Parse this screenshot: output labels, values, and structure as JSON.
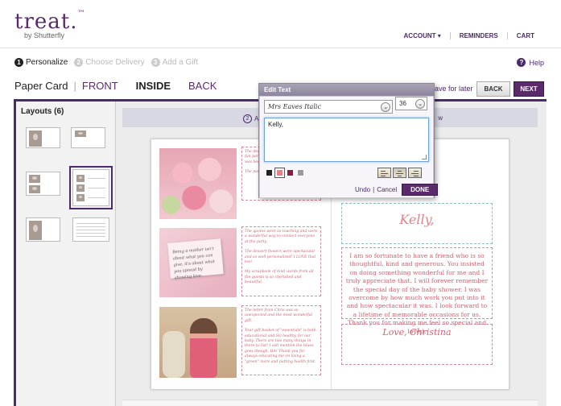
{
  "brand": {
    "name": "treat.",
    "trademark": "™",
    "sub": "by Shutterfly"
  },
  "topnav": {
    "account": "ACCOUNT ▾",
    "reminders": "REMINDERS",
    "cart": "CART"
  },
  "steps": [
    {
      "num": "1",
      "label": "Personalize"
    },
    {
      "num": "2",
      "label": "Choose Delivery"
    },
    {
      "num": "3",
      "label": "Add a Gift"
    }
  ],
  "help": {
    "icon": "?",
    "label": "Help"
  },
  "tabs": {
    "card": "Paper Card",
    "front": "FRONT",
    "inside": "INSIDE",
    "back": "BACK"
  },
  "actions": {
    "save_later": "ave for later",
    "back": "BACK",
    "next": "NEXT"
  },
  "layouts": {
    "title": "Layouts (6)"
  },
  "toolbar": {
    "step_num": "2",
    "left_text": "A",
    "right_text": "w"
  },
  "card_left": {
    "box1": [
      "The decor",
      "fun party",
      "was beau",
      "The party"
    ],
    "box2": [
      "The quotes were so touching and were a wonderful way to connect everyone at the party.",
      "The dessert flowers were spectacular and so well personalized! I LOVE that too!",
      "My scrapbook of kind words from all the guests is so cherished and beautiful."
    ],
    "box3": [
      "The letter from Chris was so unexpected and the most wonderful gift.",
      "Your gift basket of \"essentials\" is both educational and SO healthy for our baby. There are two many things in there to list! I will mention the blues goes though. HA! Thank you for always educating me on living a \"green\" more and putting health first."
    ],
    "photo2_card": "Being a mother isn't about what you can give, it's about what you spread by showing love."
  },
  "card_right": {
    "greeting": "Kelly,",
    "message": "I am so fortunate to have a friend who is so thoughtful, kind and generous. You insisted on doing something wonderful for me and I truly appreciate that. I will forever remember the special day of the baby shower. I was overcome by how much work you put into it and how spectacular it was. I look forward to a lifetime of memorable occasions for us. Thank you for making me feel so special and loved.",
    "signature": "Love, Christina"
  },
  "edit_dialog": {
    "title": "Edit Text",
    "font": "Mrs Eaves Italic",
    "size": "36",
    "text": "Kelly,",
    "swatches": [
      "#222222",
      "#e8808a",
      "#8a1a4a",
      "#9a9a9a"
    ],
    "undo": "Undo",
    "separator": "|",
    "cancel": "Cancel",
    "done": "DONE"
  }
}
